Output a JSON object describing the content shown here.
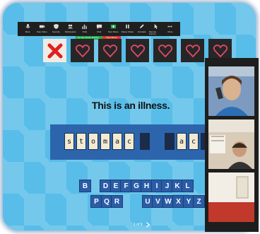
{
  "toolbar": {
    "buttons": [
      {
        "label": "Mute",
        "icon": "microphone-icon"
      },
      {
        "label": "Stop Video",
        "icon": "video-camera-icon"
      },
      {
        "label": "Security",
        "icon": "shield-icon"
      },
      {
        "label": "Participants",
        "icon": "participants-icon"
      },
      {
        "label": "Polls",
        "icon": "polls-icon"
      },
      {
        "label": "Chat",
        "icon": "chat-icon"
      },
      {
        "label": "New Share",
        "icon": "share-screen-icon"
      },
      {
        "label": "Pause Share",
        "icon": "pause-icon"
      },
      {
        "label": "Annotate",
        "icon": "annotate-icon"
      },
      {
        "label": "Remote Control",
        "icon": "remote-control-icon"
      },
      {
        "label": "More",
        "icon": "more-icon"
      }
    ],
    "sharing_banner": "You are screen sharing",
    "stop_share_label": "Stop Share",
    "accent_green": "#22a84a",
    "accent_red": "#e03535"
  },
  "game": {
    "lives": [
      "miss",
      "heart",
      "heart",
      "heart",
      "heart",
      "heart",
      "heart"
    ],
    "clue": "This is an illness.",
    "word_letters": [
      "s",
      "t",
      "o",
      "m",
      "a",
      "c",
      "",
      "",
      "a",
      "c",
      ""
    ],
    "keyboard_row1": [
      "B",
      "",
      "D",
      "E",
      "F",
      "G",
      "H",
      "I",
      "J",
      "K",
      "L"
    ],
    "keyboard_row2": [
      "P",
      "Q",
      "R",
      "",
      "",
      "U",
      "V",
      "W",
      "X",
      "Y",
      "Z"
    ],
    "page_indicator": "1 of 9",
    "colors": {
      "background": "#58bde8",
      "word_bar": "#2d65ad",
      "key": "#2a5da8",
      "life_tile": "#262626",
      "miss": "#e02020",
      "heart": "#e04a6a"
    }
  },
  "participants": [
    {
      "name": "",
      "scene": "boy-on-phone"
    },
    {
      "name": "",
      "scene": "child-in-room"
    },
    {
      "name": "",
      "scene": "room-wall"
    }
  ]
}
